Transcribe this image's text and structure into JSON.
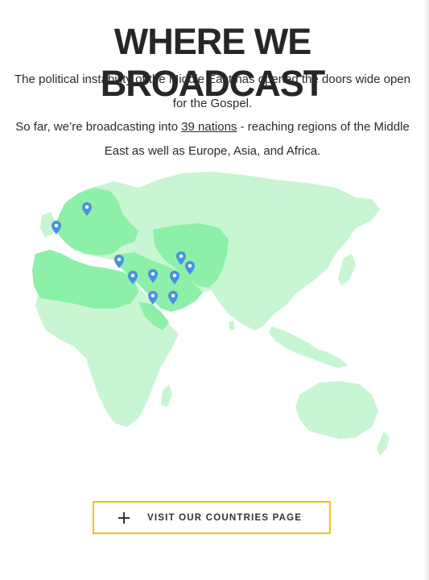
{
  "heading": "WHERE WE BROADCAST",
  "intro": {
    "line1": "The political instability of the Middle East has opened the doors wide open for the Gospel.",
    "line2_prefix": "So far, we’re broadcasting into ",
    "line2_link": "39 nations",
    "line2_suffix": " - reaching regions of the Middle East as well as Europe, Asia, and Africa."
  },
  "map": {
    "land_color": "#c8f5d2",
    "broadcast_color": "#8cf0a8",
    "marker_color": "#4a90e2",
    "marker_icon": "map-pin-icon"
  },
  "cta": {
    "icon": "plus-icon",
    "label": "VISIT OUR COUNTRIES PAGE",
    "border_color": "#f2c21a"
  }
}
